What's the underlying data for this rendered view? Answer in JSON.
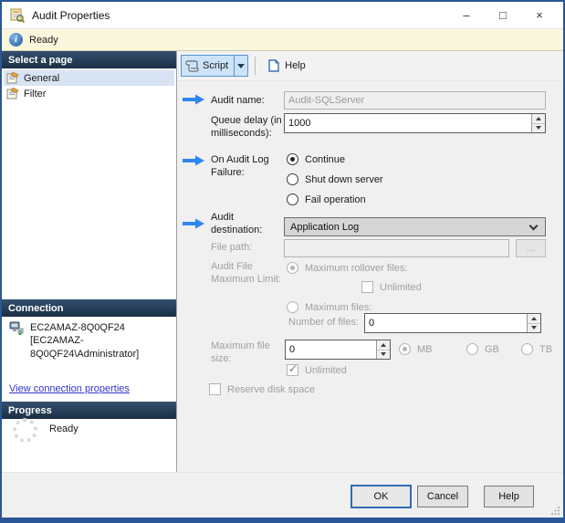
{
  "window": {
    "title": "Audit Properties",
    "minimize_glyph": "–",
    "maximize_glyph": "□",
    "close_glyph": "×"
  },
  "statusbar": {
    "ready_text": "Ready"
  },
  "sidebar": {
    "select_page_header": "Select a page",
    "pages": [
      {
        "label": "General"
      },
      {
        "label": "Filter"
      }
    ],
    "connection_header": "Connection",
    "connection_text": "EC2AMAZ-8Q0QF24 [EC2AMAZ-8Q0QF24\\Administrator]",
    "connection_link": "View connection properties",
    "progress_header": "Progress",
    "progress_status": "Ready"
  },
  "toolbar": {
    "script_label": "Script",
    "help_label": "Help"
  },
  "form": {
    "audit_name": {
      "label": "Audit name:",
      "value": "Audit-SQLServer"
    },
    "queue_delay": {
      "label": "Queue delay (in milliseconds):",
      "value": "1000"
    },
    "on_failure": {
      "label": "On Audit Log Failure:",
      "continue": "Continue",
      "shutdown": "Shut down server",
      "fail": "Fail operation"
    },
    "destination": {
      "label": "Audit destination:",
      "value": "Application Log"
    },
    "file_path": {
      "label": "File path:",
      "value": "",
      "browse": "..."
    },
    "max_limit": {
      "label": "Audit File Maximum Limit:",
      "rollover": "Maximum rollover files:",
      "rollover_unlimited": "Unlimited",
      "max_files": "Maximum files:",
      "number_label": "Number of files:",
      "number_value": "0"
    },
    "max_size": {
      "label": "Maximum file size:",
      "value": "0",
      "mb": "MB",
      "gb": "GB",
      "tb": "TB",
      "unlimited": "Unlimited"
    },
    "reserve_label": "Reserve disk space"
  },
  "footer": {
    "ok": "OK",
    "cancel": "Cancel",
    "help": "Help"
  },
  "colors": {
    "window_border": "#2a5795",
    "section_header_top": "#33506e",
    "section_header_bottom": "#1b2f44",
    "selected_page_bg": "#d8e4f3",
    "arrow_blue": "#2e86f0",
    "link_blue": "#3333cc",
    "statusbar_bg": "#fbf7dd",
    "script_button_bg": "#cde3f8",
    "script_button_border": "#5a93cf"
  }
}
